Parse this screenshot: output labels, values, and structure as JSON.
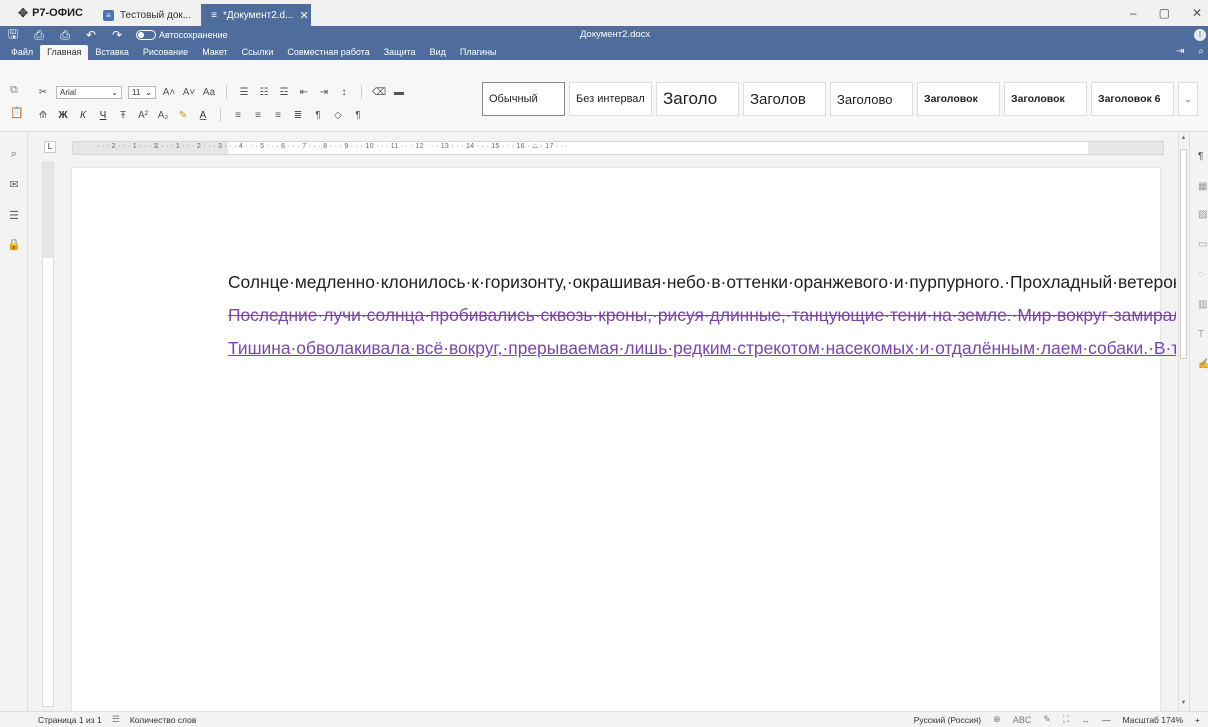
{
  "titlebar": {
    "app_name": "Р7-ОФИС",
    "tabs": [
      {
        "label": "Тестовый док...",
        "active": false
      },
      {
        "label": "*Документ2.d...",
        "active": true
      }
    ],
    "controls": {
      "minimize": "–",
      "maximize": "▢",
      "close": "✕"
    }
  },
  "quickbar": {
    "autosave_label": "Автосохранение",
    "document_name": "Документ2.docx",
    "user_initial": "I"
  },
  "menu": {
    "items": [
      "Файл",
      "Главная",
      "Вставка",
      "Рисование",
      "Макет",
      "Ссылки",
      "Совместная работа",
      "Защита",
      "Вид",
      "Плагины"
    ],
    "active": "Главная"
  },
  "ribbon": {
    "font_name": "Arial",
    "font_size": "11",
    "bold": "Ж",
    "italic": "К",
    "underline": "Ч",
    "strike": "Ŧ",
    "superscript": "A²",
    "subscript": "A₂",
    "grow_font": "A˄",
    "shrink_font": "A˅",
    "change_case": "Aa",
    "font_color": "A",
    "paragraph_mark": "¶",
    "styles": [
      {
        "label": "Обычный",
        "kind": "s-n"
      },
      {
        "label": "Без интервал",
        "kind": "s-n"
      },
      {
        "label": "Заголо",
        "kind": "s-h1"
      },
      {
        "label": "Заголов",
        "kind": "s-h2"
      },
      {
        "label": "Заголово",
        "kind": "s-h3"
      },
      {
        "label": "Заголовок",
        "kind": "s-b"
      },
      {
        "label": "Заголовок",
        "kind": "s-b"
      },
      {
        "label": "Заголовок 6",
        "kind": "s-b"
      }
    ]
  },
  "ruler": {
    "text": "· · · 2 · · · 1 · · · ⧖ · · · 1 · · · 2 · · · 3 · · · 4 · · · 5 · · · 6 · · · 7 · · · 8 · · · 9 · · · 10 · · · 11 · · · 12 · · · 13 · · · 14 · · · 15 · · · 16 · △ · 17 · · ·",
    "corner": "L"
  },
  "document": {
    "paragraphs": [
      {
        "text": "Солнце·медленно·клонилось·к·горизонту,·окрашивая·небо·в·оттенки·оранжевого·и·пурпурного.·Прохладный·ветерок·шелестел·листвой·старых·деревьев,·принося·с·собой·аромат·свежескошенной·травы.·Вдали·раздавался·тихий·рокот·прибоя,·напоминающий·о·бескрайних·просторах·океана.·Стая·птиц·стремительно·пролетела·над·головой,·направляясь·к·своим·ночным·убежищам.·Этот·вечер·обещал·быть·спокойным·и·безмятежным,·идеальным·для·размышлений.",
        "ellipsis": "...",
        "mark": "¶"
      },
      {
        "text": "Последние·лучи·солнца·пробивались·сквозь·кроны,·рисуя·длинные,·танцующие·тени·на·земле.·Мир·вокруг·замирал,·готовясь·встретить·ночь.¶",
        "change": "deleted"
      },
      {
        "text": "Тишина·обволакивала·всё·вокруг,·прерываемая·лишь·редким·стрекотом·насекомых·и·отдалённым·лаем·собаки.·В·такие·моменты·особенно·остро·чувствуешь·связь·с·природой,·её·величие·и·умиротворение.·Казалось,·время·замедлило·свой·ход,·давая·возможность·насладиться·каждым·мгновением·уходящего·дня.¶",
        "change": "inserted"
      }
    ],
    "track_change_color": "#7b44b0"
  },
  "status": {
    "page_info": "Страница 1 из 1",
    "word_count_label": "Количество слов",
    "language": "Русский (Россия)",
    "zoom_label": "Масштаб 174%",
    "zoom_minus": "—",
    "zoom_plus": "+"
  },
  "colors": {
    "header_blue": "#4e6d9c"
  }
}
